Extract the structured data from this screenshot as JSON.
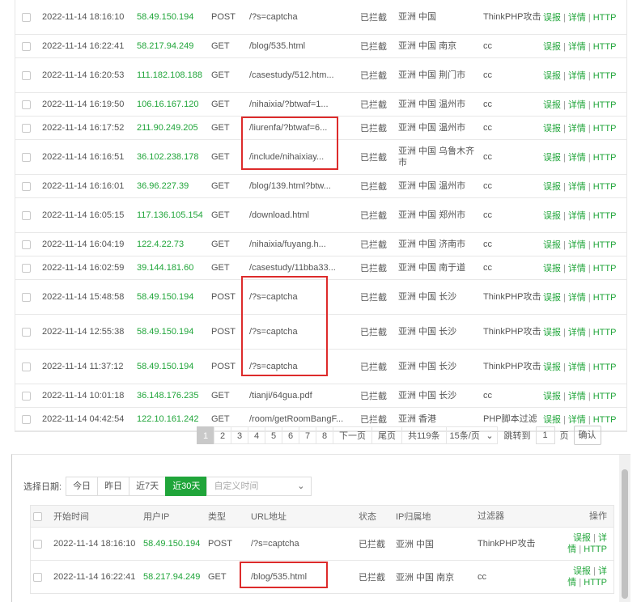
{
  "top_table": {
    "op_labels": {
      "report": "误报",
      "detail": "详情",
      "http": "HTTP",
      "sep": "|"
    },
    "rows": [
      {
        "time": "2022-11-14 18:16:10",
        "ip": "58.49.150.194",
        "type": "POST",
        "url": "/?s=captcha",
        "status": "已拦截",
        "location": "亚洲 中国",
        "filter": "ThinkPHP攻击"
      },
      {
        "time": "2022-11-14 16:22:41",
        "ip": "58.217.94.249",
        "type": "GET",
        "url": "/blog/535.html",
        "status": "已拦截",
        "location": "亚洲 中国 南京",
        "filter": "cc"
      },
      {
        "time": "2022-11-14 16:20:53",
        "ip": "111.182.108.188",
        "type": "GET",
        "url": "/casestudy/512.htm...",
        "status": "已拦截",
        "location": "亚洲 中国 荆门市",
        "filter": "cc"
      },
      {
        "time": "2022-11-14 16:19:50",
        "ip": "106.16.167.120",
        "type": "GET",
        "url": "/nihaixia/?btwaf=1...",
        "status": "已拦截",
        "location": "亚洲 中国 温州市",
        "filter": "cc"
      },
      {
        "time": "2022-11-14 16:17:52",
        "ip": "211.90.249.205",
        "type": "GET",
        "url": "/liurenfa/?btwaf=6...",
        "status": "已拦截",
        "location": "亚洲 中国 温州市",
        "filter": "cc"
      },
      {
        "time": "2022-11-14 16:16:51",
        "ip": "36.102.238.178",
        "type": "GET",
        "url": "/include/nihaixiay...",
        "status": "已拦截",
        "location": "亚洲 中国 乌鲁木齐市",
        "filter": "cc"
      },
      {
        "time": "2022-11-14 16:16:01",
        "ip": "36.96.227.39",
        "type": "GET",
        "url": "/blog/139.html?btw...",
        "status": "已拦截",
        "location": "亚洲 中国 温州市",
        "filter": "cc"
      },
      {
        "time": "2022-11-14 16:05:15",
        "ip": "117.136.105.154",
        "type": "GET",
        "url": "/download.html",
        "status": "已拦截",
        "location": "亚洲 中国 郑州市",
        "filter": "cc"
      },
      {
        "time": "2022-11-14 16:04:19",
        "ip": "122.4.22.73",
        "type": "GET",
        "url": "/nihaixia/fuyang.h...",
        "status": "已拦截",
        "location": "亚洲 中国 济南市",
        "filter": "cc"
      },
      {
        "time": "2022-11-14 16:02:59",
        "ip": "39.144.181.60",
        "type": "GET",
        "url": "/casestudy/11bba33...",
        "status": "已拦截",
        "location": "亚洲 中国 南于道",
        "filter": "cc"
      },
      {
        "time": "2022-11-14 15:48:58",
        "ip": "58.49.150.194",
        "type": "POST",
        "url": "/?s=captcha",
        "status": "已拦截",
        "location": "亚洲 中国 长沙",
        "filter": "ThinkPHP攻击"
      },
      {
        "time": "2022-11-14 12:55:38",
        "ip": "58.49.150.194",
        "type": "POST",
        "url": "/?s=captcha",
        "status": "已拦截",
        "location": "亚洲 中国 长沙",
        "filter": "ThinkPHP攻击"
      },
      {
        "time": "2022-11-14 11:37:12",
        "ip": "58.49.150.194",
        "type": "POST",
        "url": "/?s=captcha",
        "status": "已拦截",
        "location": "亚洲 中国 长沙",
        "filter": "ThinkPHP攻击"
      },
      {
        "time": "2022-11-14 10:01:18",
        "ip": "36.148.176.235",
        "type": "GET",
        "url": "/tianji/64gua.pdf",
        "status": "已拦截",
        "location": "亚洲 中国 长沙",
        "filter": "cc"
      },
      {
        "time": "2022-11-14 04:42:54",
        "ip": "122.10.161.242",
        "type": "GET",
        "url": "/room/getRoomBangF...",
        "status": "已拦截",
        "location": "亚洲 香港",
        "filter": "PHP脚本过滤"
      }
    ]
  },
  "pagination": {
    "pages": [
      "1",
      "2",
      "3",
      "4",
      "5",
      "6",
      "7",
      "8"
    ],
    "current": "1",
    "next": "下一页",
    "last": "尾页",
    "total": "共119条",
    "per_page": "15条/页",
    "jump_label": "跳转到",
    "jump_value": "1",
    "page_unit": "页",
    "confirm": "确认"
  },
  "bottom": {
    "date_label": "选择日期:",
    "date_tabs": [
      "今日",
      "昨日",
      "近7天",
      "近30天"
    ],
    "active_tab": "近30天",
    "custom_placeholder": "自定义时间",
    "headers": {
      "time": "开始时间",
      "ip": "用户IP",
      "type": "类型",
      "url": "URL地址",
      "status": "状态",
      "location": "IP归属地",
      "filter": "过滤器",
      "ops": "操作"
    },
    "op_labels": {
      "report": "误报",
      "detail_a": "详",
      "detail_b": "情",
      "http": "HTTP",
      "sep": "|"
    },
    "rows": [
      {
        "time": "2022-11-14 18:16:10",
        "ip": "58.49.150.194",
        "type": "POST",
        "url": "/?s=captcha",
        "status": "已拦截",
        "location": "亚洲 中国",
        "filter": "ThinkPHP攻击"
      },
      {
        "time": "2022-11-14 16:22:41",
        "ip": "58.217.94.249",
        "type": "GET",
        "url": "/blog/535.html",
        "status": "已拦截",
        "location": "亚洲 中国 南京",
        "filter": "cc"
      }
    ]
  },
  "colors": {
    "accent": "#20a53a",
    "highlight_box": "#dd2b2b"
  }
}
